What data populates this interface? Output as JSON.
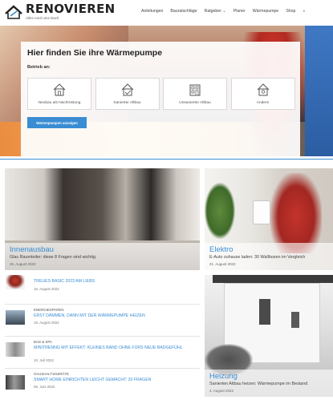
{
  "header": {
    "logo_title": "RENOVIEREN",
    "logo_tagline": "Alles rund ums Dach",
    "nav": [
      "Anleitungen",
      "Bauratschläge",
      "Ratgeber",
      "Planer",
      "Wärmepumpe",
      "Shop"
    ],
    "nav_dropdown_index": 2
  },
  "hero": {
    "title": "Hier finden Sie ihre Wärmepumpe",
    "subtitle": "Betrieb an:",
    "options": [
      {
        "label": "Neubau als Nachrüstung",
        "icon": "house-icon"
      },
      {
        "label": "Sanierter Altbau",
        "icon": "renovated-house-icon"
      },
      {
        "label": "Unsanierter Altbau",
        "icon": "old-house-icon"
      },
      {
        "label": "Andere",
        "icon": "other-house-icon"
      }
    ],
    "button_label": "Wärmepumpen anzeigen"
  },
  "features": {
    "innenausbau": {
      "category": "Innenausbau",
      "description": "Glas Raumteiler: diese 8 Fragen sind wichtig",
      "date": "25. August 2022"
    },
    "elektro": {
      "category": "Elektro",
      "description": "E-Auto zuhause laden: 30 Wallboxen im Vergleich",
      "date": "31. August 2022"
    },
    "heizung": {
      "category": "Heizung",
      "description": "Sanierten Altbau heizen: Wärmepumpe im Bestand",
      "date": "4. August 2022"
    }
  },
  "news": [
    {
      "category": "",
      "title": "TREUES BASIC 2023 AM LIEBS",
      "date": "16. August 2022",
      "thumb": "person-thumb"
    },
    {
      "category": "ENERGIESPAREN",
      "title": "ERST DÄMMEN, DANN MIT DER WÄRMEPUMPE HEIZEN",
      "date": "16. August 2022",
      "thumb": "house-thumb"
    },
    {
      "category": "BAD & SPA",
      "title": "MINITRENNG MIT EFFEKT: KLEINES BAND OHNE FÜRS NEUE BADGEFÜHL",
      "date": "10. Juli 2022",
      "thumb": "bathroom-thumb"
    },
    {
      "category": "HAUSHALTSGERÄTE",
      "title": "SMART HOME EINRICHTEN LEICHT GEMACHT: 20 FRAGEN",
      "date": "06. Juni 2022",
      "thumb": "kitchen-thumb"
    }
  ]
}
